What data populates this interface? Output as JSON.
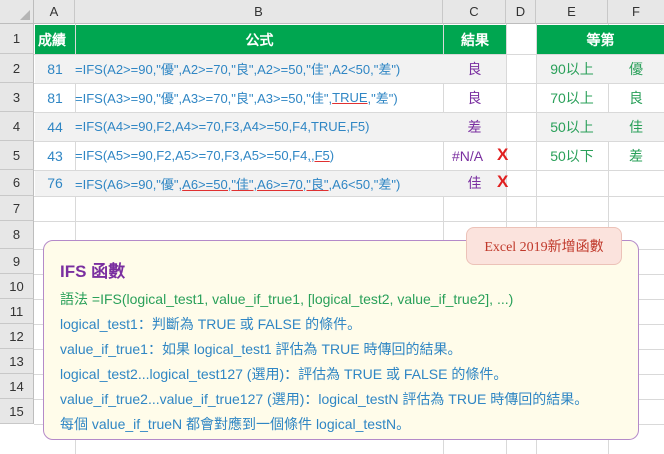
{
  "columns": [
    "A",
    "B",
    "C",
    "D",
    "E",
    "F"
  ],
  "rows": [
    "1",
    "2",
    "3",
    "4",
    "5",
    "6",
    "7",
    "8",
    "9",
    "10",
    "11",
    "12",
    "13",
    "14",
    "15"
  ],
  "table": {
    "headers": {
      "score": "成績",
      "formula": "公式",
      "result": "結果",
      "grade": "等第"
    },
    "rows": [
      {
        "score": "81",
        "formula": "=IFS(A2>=90,\"優\",A2>=70,\"良\",A2>=50,\"佳\",A2<50,\"差\")",
        "result": "良"
      },
      {
        "score": "81",
        "formula_pre": "=IFS(A3>=90,\"優\",A3>=70,\"良\",A3>=50,\"佳\",",
        "formula_mark": "TRUE",
        "formula_post": ",\"差\")",
        "result": "良"
      },
      {
        "score": "44",
        "formula": "=IFS(A4>=90,F2,A4>=70,F3,A4>=50,F4,TRUE,F5)",
        "result": "差"
      },
      {
        "score": "43",
        "formula_pre": "=IFS(A5>=90,F2,A5>=70,F3,A5>=50,F4",
        "formula_mark": ",,F5",
        "formula_post": ")",
        "result": "#N/A",
        "mark": "X"
      },
      {
        "score": "76",
        "formula_pre": "=IFS(A6>=90,\"優\",",
        "formula_mark": "A6>=50,\"佳\",A6>=70,\"良\"",
        "formula_post": ",A6<50,\"差\")",
        "result": "佳",
        "mark": "X"
      }
    ],
    "grades": [
      {
        "threshold": "90以上",
        "grade": "優"
      },
      {
        "threshold": "70以上",
        "grade": "良"
      },
      {
        "threshold": "50以上",
        "grade": "佳"
      },
      {
        "threshold": "50以下",
        "grade": "差"
      }
    ]
  },
  "badge": "Excel 2019新增函數",
  "note": {
    "title": "IFS 函數",
    "syntax": "語法 =IFS(logical_test1, value_if_true1, [logical_test2, value_if_true2], ...)",
    "lines": [
      "logical_test1：判斷為 TRUE 或 FALSE 的條件。",
      "value_if_true1：如果 logical_test1 評估為 TRUE 時傳回的結果。",
      "logical_test2...logical_test127 (選用)：評估為 TRUE 或 FALSE 的條件。",
      "value_if_true2...value_if_true127 (選用)：logical_testN 評估為 TRUE 時傳回的結果。",
      "每個 value_if_trueN 都會對應到一個條件 logical_testN。"
    ]
  },
  "colors": {
    "header_green": "#00a650",
    "formula_blue": "#2f86c4",
    "result_purple": "#7a2fa0",
    "grade_green": "#2aa05a",
    "error_red": "#e02020"
  }
}
